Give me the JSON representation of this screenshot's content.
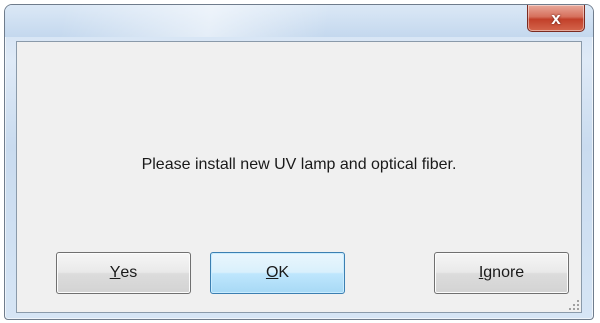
{
  "window": {
    "close_glyph": "x",
    "close_icon": "close-icon"
  },
  "dialog": {
    "message": "Please install new UV lamp and optical fiber.",
    "buttons": [
      {
        "mnemonic": "Y",
        "rest": "es"
      },
      {
        "mnemonic": "O",
        "rest": "K"
      },
      {
        "mnemonic": "I",
        "rest": "gnore"
      }
    ]
  },
  "colors": {
    "close_button": "#c2402a",
    "default_button_border": "#3c7fb1"
  }
}
